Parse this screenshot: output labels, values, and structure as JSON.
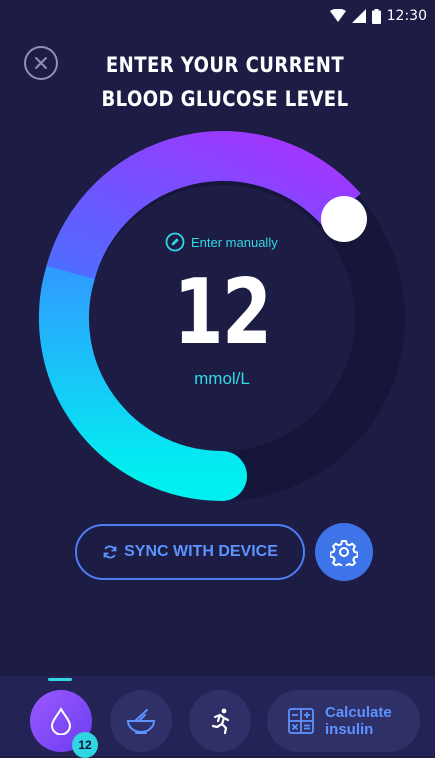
{
  "status_bar": {
    "time": "12:30"
  },
  "header": {
    "close_icon": "close-icon",
    "title": "ENTER YOUR CURRENT\nBLOOD GLUCOSE LEVEL"
  },
  "dial": {
    "enter_manually": "Enter manually",
    "value": "12",
    "unit": "mmol/L",
    "colors": {
      "start": "#00f0f0",
      "mid": "#4f6cff",
      "end": "#a534ff",
      "track": "#16163a",
      "inner": "#1c1c44"
    }
  },
  "actions": {
    "sync_label": "SYNC WITH DEVICE",
    "sync_icon": "sync-icon",
    "settings_icon": "gear-icon"
  },
  "bottom_nav": {
    "items": [
      {
        "name": "glucose",
        "icon": "drop-icon",
        "badge": "12"
      },
      {
        "name": "food",
        "icon": "bowl-icon"
      },
      {
        "name": "activity",
        "icon": "running-icon"
      }
    ],
    "calculate_label": "Calculate\ninsulin",
    "calculate_icon": "calculator-icon"
  },
  "colors": {
    "background": "#1c1c44",
    "accent_cyan": "#32d7e4",
    "accent_blue": "#4d7ff1",
    "accent_purple": "#8b4dff"
  }
}
